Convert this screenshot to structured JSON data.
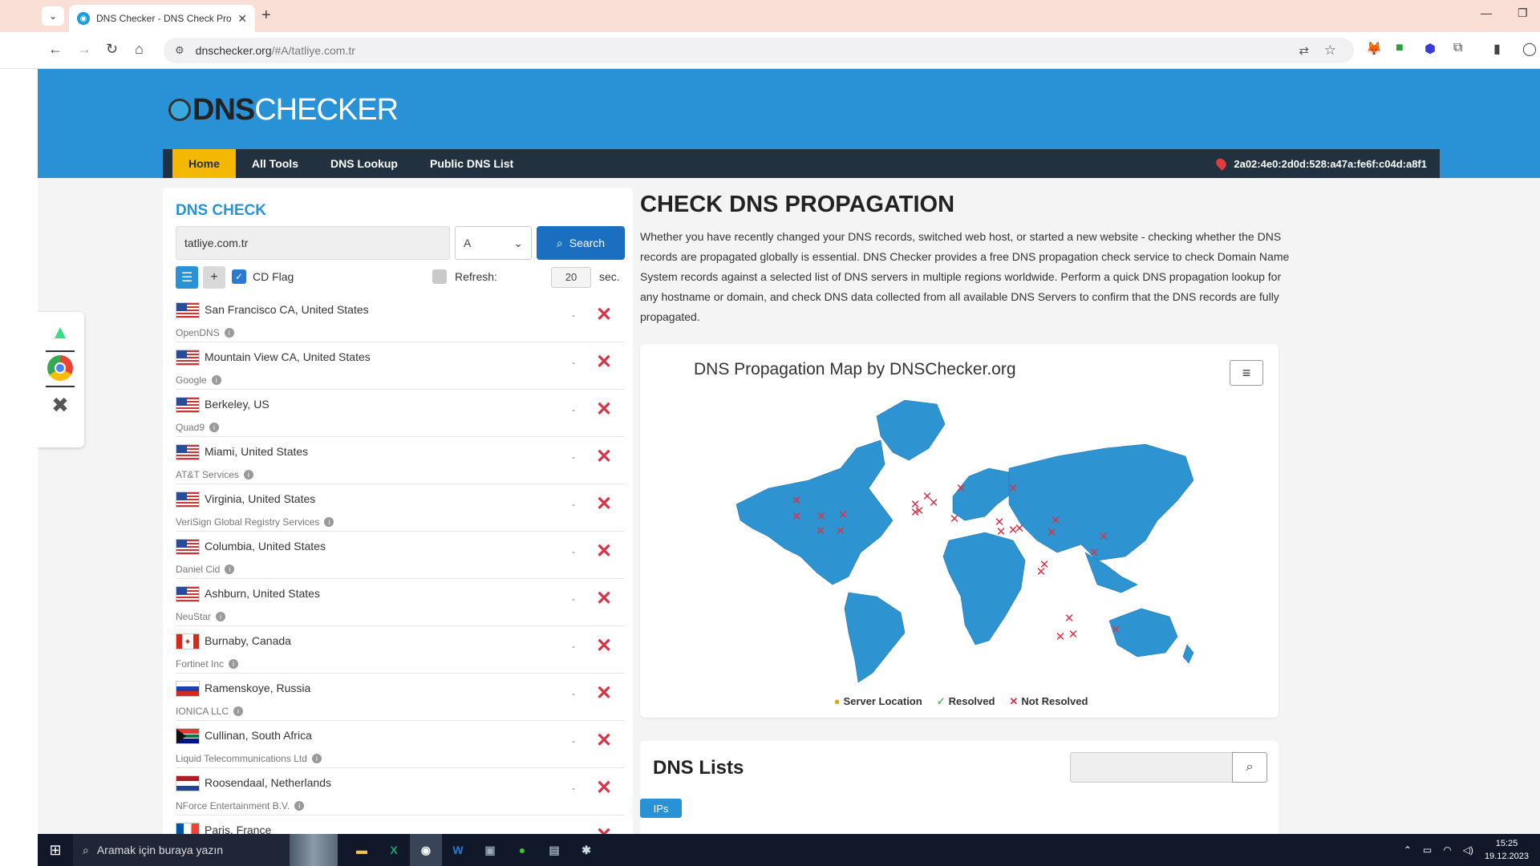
{
  "browser": {
    "tab_title": "DNS Checker - DNS Check Prop",
    "address_host": "dnschecker.org",
    "address_path": "/#A/tatliye.com.tr"
  },
  "site": {
    "logo_part1": "DNS",
    "logo_part2": "CHECKER",
    "nav": [
      "Home",
      "All Tools",
      "DNS Lookup",
      "Public DNS List"
    ],
    "active_nav": "Home",
    "user_ip": "2a02:4e0:2d0d:528:a47a:fe6f:c04d:a8f1"
  },
  "dns_check": {
    "title": "DNS CHECK",
    "domain_value": "tatliye.com.tr",
    "record_type": "A",
    "search_label": "Search",
    "cd_flag_label": "CD Flag",
    "refresh_label": "Refresh:",
    "refresh_value": "20",
    "refresh_unit": "sec.",
    "servers": [
      {
        "city": "San Francisco CA, United States",
        "provider": "OpenDNS",
        "country": "us",
        "result": "-"
      },
      {
        "city": "Mountain View CA, United States",
        "provider": "Google",
        "country": "us",
        "result": "-"
      },
      {
        "city": "Berkeley, US",
        "provider": "Quad9",
        "country": "us",
        "result": "-"
      },
      {
        "city": "Miami, United States",
        "provider": "AT&T Services",
        "country": "us",
        "result": "-"
      },
      {
        "city": "Virginia, United States",
        "provider": "VeriSign Global Registry Services",
        "country": "us",
        "result": "-"
      },
      {
        "city": "Columbia, United States",
        "provider": "Daniel Cid",
        "country": "us",
        "result": "-"
      },
      {
        "city": "Ashburn, United States",
        "provider": "NeuStar",
        "country": "us",
        "result": "-"
      },
      {
        "city": "Burnaby, Canada",
        "provider": "Fortinet Inc",
        "country": "ca",
        "result": "-"
      },
      {
        "city": "Ramenskoye, Russia",
        "provider": "IONICA LLC",
        "country": "ru",
        "result": "-"
      },
      {
        "city": "Cullinan, South Africa",
        "provider": "Liquid Telecommunications Ltd",
        "country": "za",
        "result": "-"
      },
      {
        "city": "Roosendaal, Netherlands",
        "provider": "NForce Entertainment B.V.",
        "country": "nl",
        "result": "-"
      },
      {
        "city": "Paris, France",
        "provider": "",
        "country": "fr",
        "result": "-"
      }
    ]
  },
  "propagation": {
    "title": "CHECK DNS PROPAGATION",
    "description": "Whether you have recently changed your DNS records, switched web host, or started a new website - checking whether the DNS records are propagated globally is essential. DNS Checker provides a free DNS propagation check service to check Domain Name System records against a selected list of DNS servers in multiple regions worldwide. Perform a quick DNS propagation lookup for any hostname or domain, and check DNS data collected from all available DNS Servers to confirm that the DNS records are fully propagated.",
    "map_title": "DNS Propagation Map by DNSChecker.org",
    "legend": [
      "Server Location",
      "Resolved",
      "Not Resolved"
    ],
    "colors": {
      "land": "#2e94d1",
      "not_resolved": "#d63447",
      "resolved": "#5cb85c",
      "server": "#e0a800"
    }
  },
  "dns_lists": {
    "title": "DNS Lists",
    "tab": "IPs"
  },
  "taskbar": {
    "search_placeholder": "Aramak için buraya yazın",
    "time": "15:25",
    "date": "19.12.2023"
  }
}
